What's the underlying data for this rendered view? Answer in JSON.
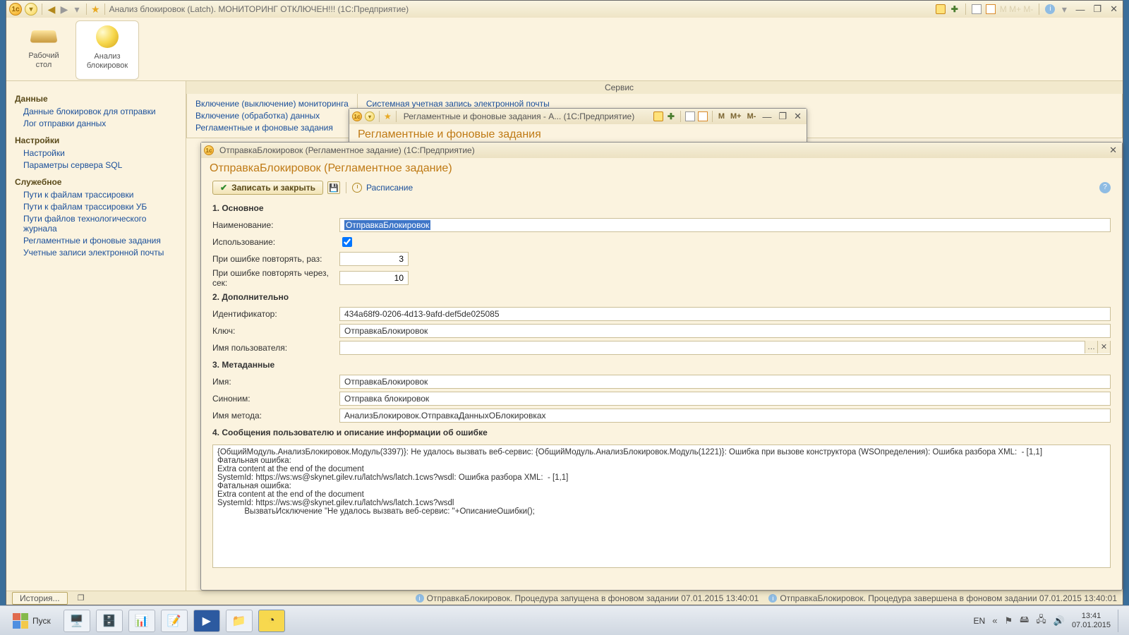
{
  "main_title": "Анализ блокировок (Latch). МОНИТОРИНГ ОТКЛЮЧЕН!!! (1С:Предприятие)",
  "dim_title_right": "",
  "big_buttons": {
    "desktop_l1": "Рабочий",
    "desktop_l2": "стол",
    "analysis_l1": "Анализ",
    "analysis_l2": "блокировок"
  },
  "sidebar": {
    "g_data": "Данные",
    "data_links": [
      "Данные блокировок для отправки",
      "Лог отправки данных"
    ],
    "g_settings": "Настройки",
    "settings_links": [
      "Настройки",
      "Параметры сервера SQL"
    ],
    "g_service": "Служебное",
    "service_links": [
      "Пути к файлам трассировки",
      "Пути к файлам трассировки УБ",
      "Пути файлов технологического журнала",
      "Регламентные и фоновые задания",
      "Учетные записи электронной почты"
    ]
  },
  "service_panel": {
    "header": "Сервис",
    "left": [
      "Включение (выключение) мониторинга",
      "Включение (обработка) данных",
      "Регламентные и фоновые задания"
    ],
    "right": [
      "Системная учетная запись электронной почты"
    ]
  },
  "sched_window": {
    "title": "Регламентные и фоновые задания - А... (1С:Предприятие)",
    "heading": "Регламентные и фоновые задания",
    "m": "M",
    "mp": "M+",
    "mm": "M-"
  },
  "dialog": {
    "title": "ОтправкаБлокировок (Регламентное задание) (1С:Предприятие)",
    "heading": "ОтправкаБлокировок (Регламентное задание)",
    "save_close": "Записать и закрыть",
    "schedule": "Расписание",
    "s1": "1. Основное",
    "l_name": "Наименование:",
    "v_name": "ОтправкаБлокировок",
    "l_use": "Использование:",
    "l_retry": "При ошибке повторять, раз:",
    "v_retry": "3",
    "l_retry_sec": "При ошибке повторять через, сек:",
    "v_retry_sec": "10",
    "s2": "2. Дополнительно",
    "l_id": "Идентификатор:",
    "v_id": "434a68f9-0206-4d13-9afd-def5de025085",
    "l_key": "Ключ:",
    "v_key": "ОтправкаБлокировок",
    "l_user": "Имя пользователя:",
    "v_user": "",
    "s3": "3. Метаданные",
    "l_mname": "Имя:",
    "v_mname": "ОтправкаБлокировок",
    "l_syn": "Синоним:",
    "v_syn": "Отправка блокировок",
    "l_method": "Имя метода:",
    "v_method": "АнализБлокировок.ОтправкаДанныхОБлокировках",
    "s4": "4. Сообщения пользователю и описание информации об ошибке",
    "error_text": "{ОбщийМодуль.АнализБлокировок.Модуль(3397)}: Не удалось вызвать веб-сервис: {ОбщийМодуль.АнализБлокировок.Модуль(1221)}: Ошибка при вызове конструктора (WSОпределения): Ошибка разбора XML:  - [1,1]\nФатальная ошибка:\nExtra content at the end of the document\nSystemId: https://ws:ws@skynet.gilev.ru/latch/ws/latch.1cws?wsdl: Ошибка разбора XML:  - [1,1]\nФатальная ошибка:\nExtra content at the end of the document\nSystemId: https://ws:ws@skynet.gilev.ru/latch/ws/latch.1cws?wsdl\n            ВызватьИсключение \"Не удалось вызвать веб-сервис: \"+ОписаниеОшибки();"
  },
  "statusbar": {
    "history": "История...",
    "msg1": "ОтправкаБлокировок. Процедура запущена в фоновом задании 07.01.2015 13:40:01",
    "msg2": "ОтправкаБлокировок. Процедура завершена в фоновом задании 07.01.2015 13:40:01"
  },
  "taskbar": {
    "start": "Пуск",
    "lang": "EN",
    "time": "13:41",
    "date": "07.01.2015"
  }
}
